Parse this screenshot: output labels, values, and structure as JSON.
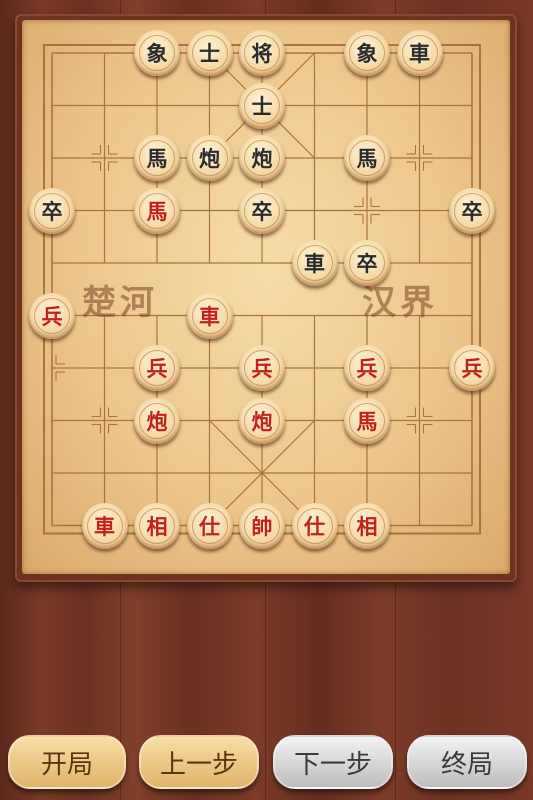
{
  "board": {
    "river_left": "楚河",
    "river_right": "汉界"
  },
  "pieces": [
    {
      "label": "象",
      "side": "black",
      "col": 2,
      "row": 0
    },
    {
      "label": "士",
      "side": "black",
      "col": 3,
      "row": 0
    },
    {
      "label": "将",
      "side": "black",
      "col": 4,
      "row": 0
    },
    {
      "label": "象",
      "side": "black",
      "col": 6,
      "row": 0
    },
    {
      "label": "車",
      "side": "black",
      "col": 7,
      "row": 0
    },
    {
      "label": "士",
      "side": "black",
      "col": 4,
      "row": 1
    },
    {
      "label": "馬",
      "side": "black",
      "col": 2,
      "row": 2
    },
    {
      "label": "炮",
      "side": "black",
      "col": 3,
      "row": 2
    },
    {
      "label": "炮",
      "side": "black",
      "col": 4,
      "row": 2
    },
    {
      "label": "馬",
      "side": "black",
      "col": 6,
      "row": 2
    },
    {
      "label": "卒",
      "side": "black",
      "col": 0,
      "row": 3
    },
    {
      "label": "馬",
      "side": "red",
      "col": 2,
      "row": 3
    },
    {
      "label": "卒",
      "side": "black",
      "col": 4,
      "row": 3
    },
    {
      "label": "卒",
      "side": "black",
      "col": 8,
      "row": 3
    },
    {
      "label": "車",
      "side": "black",
      "col": 5,
      "row": 4
    },
    {
      "label": "卒",
      "side": "black",
      "col": 6,
      "row": 4
    },
    {
      "label": "兵",
      "side": "red",
      "col": 0,
      "row": 5
    },
    {
      "label": "車",
      "side": "red",
      "col": 3,
      "row": 5
    },
    {
      "label": "兵",
      "side": "red",
      "col": 2,
      "row": 6
    },
    {
      "label": "兵",
      "side": "red",
      "col": 4,
      "row": 6
    },
    {
      "label": "兵",
      "side": "red",
      "col": 6,
      "row": 6
    },
    {
      "label": "兵",
      "side": "red",
      "col": 8,
      "row": 6
    },
    {
      "label": "炮",
      "side": "red",
      "col": 2,
      "row": 7
    },
    {
      "label": "炮",
      "side": "red",
      "col": 4,
      "row": 7
    },
    {
      "label": "馬",
      "side": "red",
      "col": 6,
      "row": 7
    },
    {
      "label": "車",
      "side": "red",
      "col": 1,
      "row": 9
    },
    {
      "label": "相",
      "side": "red",
      "col": 2,
      "row": 9
    },
    {
      "label": "仕",
      "side": "red",
      "col": 3,
      "row": 9
    },
    {
      "label": "帥",
      "side": "red",
      "col": 4,
      "row": 9
    },
    {
      "label": "仕",
      "side": "red",
      "col": 5,
      "row": 9
    },
    {
      "label": "相",
      "side": "red",
      "col": 6,
      "row": 9
    }
  ],
  "controls": {
    "start_label": "开局",
    "prev_label": "上一步",
    "next_label": "下一步",
    "end_label": "终局"
  },
  "colors": {
    "red_piece_text": "#c4211a",
    "black_piece_text": "#2b2b2b"
  }
}
